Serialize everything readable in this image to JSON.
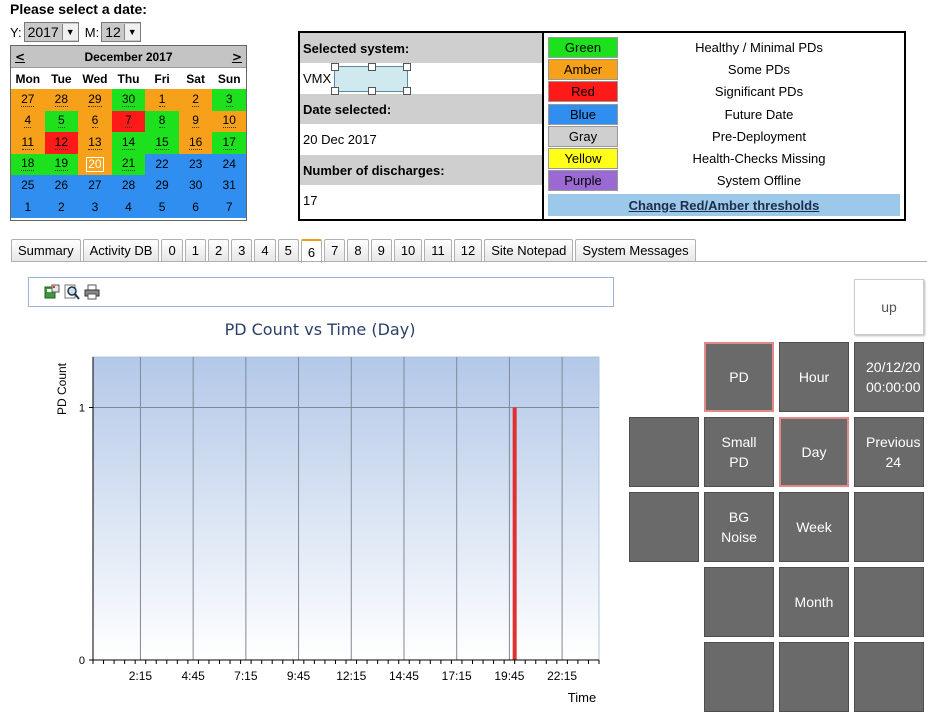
{
  "date_selector": {
    "title": "Please select a date:",
    "year_label": "Y:",
    "year_value": "2017",
    "month_label": "M:",
    "month_value": "12"
  },
  "calendar": {
    "prev": "<",
    "next": ">",
    "month_title": "December 2017",
    "weekdays": [
      "Mon",
      "Tue",
      "Wed",
      "Thu",
      "Fri",
      "Sat",
      "Sun"
    ],
    "weeks": [
      [
        {
          "d": "27",
          "c": "amber"
        },
        {
          "d": "28",
          "c": "amber"
        },
        {
          "d": "29",
          "c": "amber"
        },
        {
          "d": "30",
          "c": "green"
        },
        {
          "d": "1",
          "c": "amber"
        },
        {
          "d": "2",
          "c": "amber"
        },
        {
          "d": "3",
          "c": "green"
        }
      ],
      [
        {
          "d": "4",
          "c": "amber"
        },
        {
          "d": "5",
          "c": "green"
        },
        {
          "d": "6",
          "c": "amber"
        },
        {
          "d": "7",
          "c": "red"
        },
        {
          "d": "8",
          "c": "green"
        },
        {
          "d": "9",
          "c": "amber"
        },
        {
          "d": "10",
          "c": "amber"
        }
      ],
      [
        {
          "d": "11",
          "c": "amber"
        },
        {
          "d": "12",
          "c": "red"
        },
        {
          "d": "13",
          "c": "amber"
        },
        {
          "d": "14",
          "c": "green"
        },
        {
          "d": "15",
          "c": "green"
        },
        {
          "d": "16",
          "c": "amber"
        },
        {
          "d": "17",
          "c": "green"
        }
      ],
      [
        {
          "d": "18",
          "c": "green"
        },
        {
          "d": "19",
          "c": "green"
        },
        {
          "d": "20",
          "c": "amber",
          "today": true
        },
        {
          "d": "21",
          "c": "green"
        },
        {
          "d": "22",
          "c": "blue"
        },
        {
          "d": "23",
          "c": "blue"
        },
        {
          "d": "24",
          "c": "blue"
        }
      ],
      [
        {
          "d": "25",
          "c": "blue"
        },
        {
          "d": "26",
          "c": "blue"
        },
        {
          "d": "27",
          "c": "blue"
        },
        {
          "d": "28",
          "c": "blue"
        },
        {
          "d": "29",
          "c": "blue"
        },
        {
          "d": "30",
          "c": "blue"
        },
        {
          "d": "31",
          "c": "blue"
        }
      ],
      [
        {
          "d": "1",
          "c": "blue"
        },
        {
          "d": "2",
          "c": "blue"
        },
        {
          "d": "3",
          "c": "blue"
        },
        {
          "d": "4",
          "c": "blue"
        },
        {
          "d": "5",
          "c": "blue"
        },
        {
          "d": "6",
          "c": "blue"
        },
        {
          "d": "7",
          "c": "blue"
        }
      ]
    ]
  },
  "colors": {
    "green": "#1ee11e",
    "amber": "#f7a01a",
    "red": "#ff1a1a",
    "blue": "#2f8ef0",
    "gray": "#cfcfcf",
    "yellow": "#ffff1a",
    "purple": "#9a6ad2"
  },
  "info": {
    "selected_system_label": "Selected system:",
    "system_prefix": "VMX",
    "date_selected_label": "Date selected:",
    "date_selected_value": "20 Dec 2017",
    "discharges_label": "Number of discharges:",
    "discharges_value": "17"
  },
  "legend": [
    {
      "name": "Green",
      "color": "green",
      "desc": "Healthy / Minimal PDs"
    },
    {
      "name": "Amber",
      "color": "amber",
      "desc": "Some PDs"
    },
    {
      "name": "Red",
      "color": "red",
      "desc": "Significant PDs"
    },
    {
      "name": "Blue",
      "color": "blue",
      "desc": "Future Date"
    },
    {
      "name": "Gray",
      "color": "gray",
      "desc": "Pre-Deployment"
    },
    {
      "name": "Yellow",
      "color": "yellow",
      "desc": "Health-Checks Missing"
    },
    {
      "name": "Purple",
      "color": "purple",
      "desc": "System Offline"
    }
  ],
  "threshold_button": "Change Red/Amber thresholds",
  "tabs": [
    "Summary",
    "Activity DB",
    "0",
    "1",
    "2",
    "3",
    "4",
    "5",
    "6",
    "7",
    "8",
    "9",
    "10",
    "11",
    "12",
    "Site Notepad",
    "System Messages"
  ],
  "active_tab": "6",
  "toolbar_icons": [
    "export-icon",
    "zoom-icon",
    "print-icon"
  ],
  "chart_data": {
    "type": "bar",
    "title": "PD Count vs Time (Day)",
    "xlabel": "Time",
    "ylabel": "PD Count",
    "x_tick_labels": [
      "2:15",
      "4:45",
      "7:15",
      "9:45",
      "12:15",
      "14:45",
      "17:15",
      "19:45",
      "22:15"
    ],
    "y_tick_labels": [
      "0",
      "1"
    ],
    "xlim_hours": [
      0,
      24
    ],
    "ylim": [
      0,
      1.2
    ],
    "series": [
      {
        "values": [
          {
            "x_hours": 20.0,
            "y": 1
          }
        ]
      }
    ],
    "bar_color": "#e03030",
    "grid": true
  },
  "buttons": {
    "up": "up",
    "pd": "PD",
    "hour": "Hour",
    "datetime_line1": "20/12/20",
    "datetime_line2": "00:00:00",
    "small_pd_line1": "Small",
    "small_pd_line2": "PD",
    "day": "Day",
    "previous_line1": "Previous",
    "previous_line2": "24",
    "bg_noise_line1": "BG",
    "bg_noise_line2": "Noise",
    "week": "Week",
    "month": "Month"
  }
}
